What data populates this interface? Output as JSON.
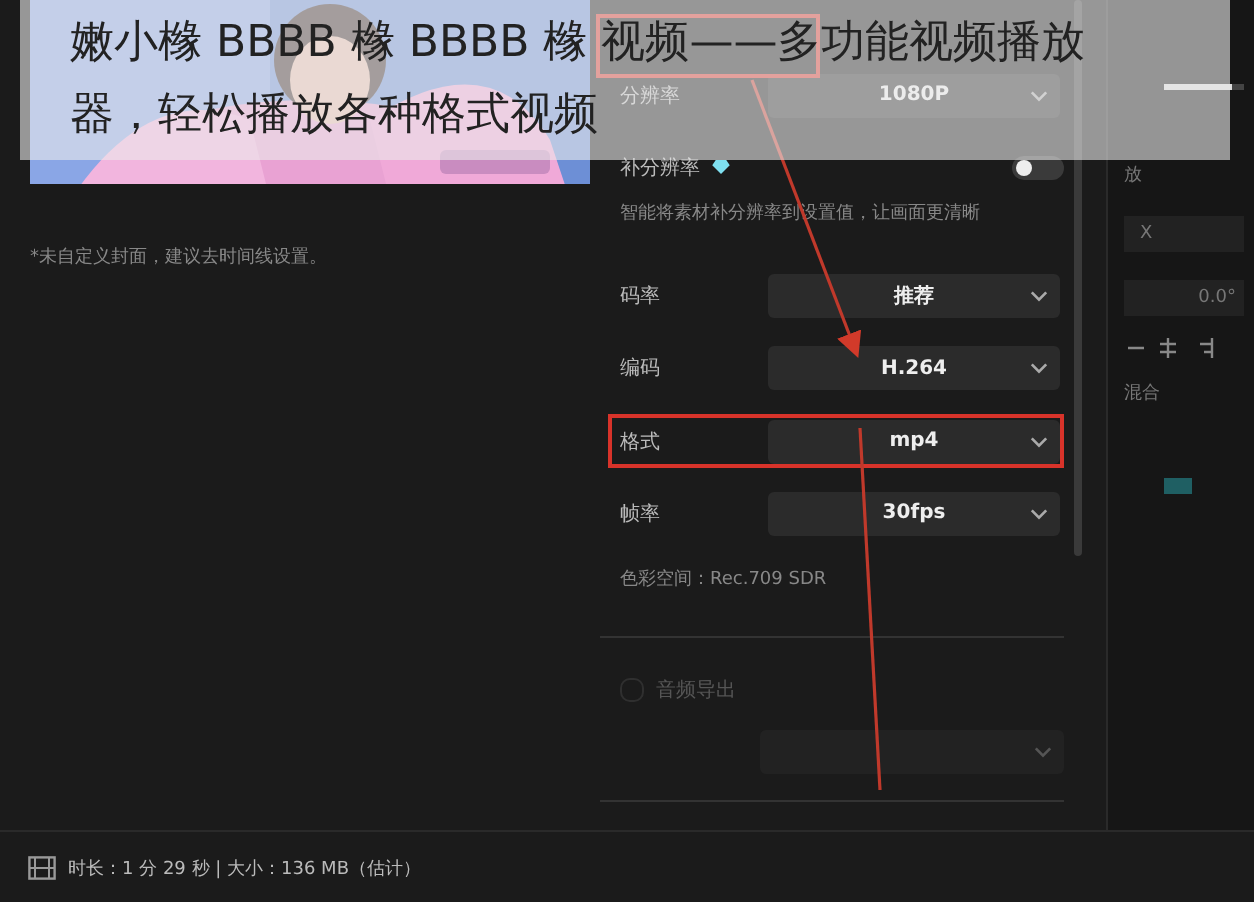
{
  "headline": "嫩小橼 BBBB 橼 BBBB 橼 视频——多功能视频播放器，轻松播放各种格式视频",
  "preview": {
    "kind": "picture",
    "caption": "*未自定义封面，建议去时间线设置。"
  },
  "settings": [
    {
      "kind": "select",
      "label": "分辨率",
      "value": "1080P",
      "highlighted": false
    },
    {
      "kind": "toggle",
      "label": "补分辨率",
      "on": false
    },
    {
      "kind": "note",
      "text": "智能将素材补分辨率到设置值，让画面更清晰"
    },
    {
      "kind": "select",
      "label": "码率",
      "value": "推荐",
      "highlighted": false
    },
    {
      "kind": "select",
      "label": "编码",
      "value": "H.264",
      "highlighted": false
    },
    {
      "kind": "select",
      "label": "格式",
      "value": "mp4",
      "highlighted": true
    },
    {
      "kind": "select",
      "label": "帧率",
      "value": "30fps",
      "highlighted": false
    },
    {
      "kind": "note",
      "text": "色彩空间：Rec.709 SDR"
    }
  ],
  "audio_export": {
    "label": "音频导出",
    "checked": false,
    "disabled": true
  },
  "side_panel": {
    "slider": {
      "level": 0.85
    },
    "label": "放",
    "x_field": "X",
    "rotation_field": "0.0°",
    "blend_label": "混合"
  },
  "status_bar": "时长：1 分 29 秒 | 大小：136 MB（估计）"
}
